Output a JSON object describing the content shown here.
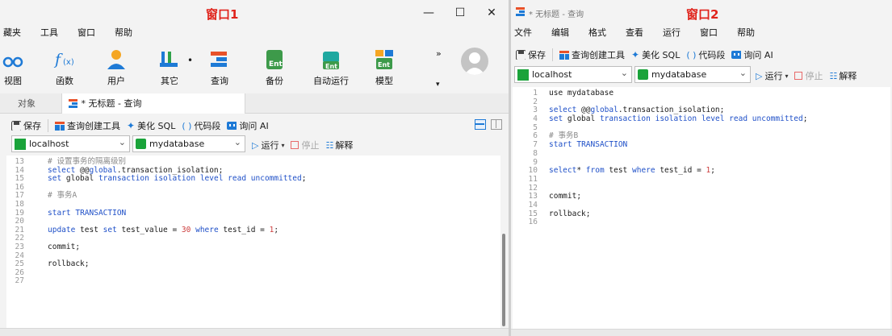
{
  "window1": {
    "title": "窗口1",
    "menu": [
      "藏夹",
      "工具",
      "窗口",
      "帮助"
    ],
    "ribbon": [
      {
        "label": "视图",
        "icon": "view-icon"
      },
      {
        "label": "函数",
        "icon": "function-icon"
      },
      {
        "label": "用户",
        "icon": "user-icon"
      },
      {
        "label": "其它",
        "icon": "tools-icon"
      },
      {
        "label": "查询",
        "icon": "query-icon"
      },
      {
        "label": "备份",
        "icon": "backup-icon"
      },
      {
        "label": "自动运行",
        "icon": "automation-icon"
      },
      {
        "label": "模型",
        "icon": "model-icon"
      }
    ],
    "overflow": "»",
    "tabs": {
      "objects": "对象",
      "query": "* 无标题 - 查询"
    },
    "toolbar": {
      "save": "保存",
      "builder": "查询创建工具",
      "beautify": "美化 SQL",
      "snippet": "代码段",
      "ai": "询问 AI"
    },
    "connection": "localhost",
    "database": "mydatabase",
    "run": {
      "run": "运行",
      "stop": "停止",
      "explain": "解释"
    },
    "code": [
      {
        "n": "13",
        "t": "# 设置事务的隔离级别"
      },
      {
        "n": "14",
        "t": "select @@global.transaction_isolation;"
      },
      {
        "n": "15",
        "t": "set global transaction isolation level read uncommitted;"
      },
      {
        "n": "16",
        "t": ""
      },
      {
        "n": "17",
        "t": "# 事务A"
      },
      {
        "n": "18",
        "t": ""
      },
      {
        "n": "19",
        "t": "start TRANSACTION"
      },
      {
        "n": "20",
        "t": ""
      },
      {
        "n": "21",
        "t": "update test set test_value = 30 where test_id = 1;"
      },
      {
        "n": "22",
        "t": ""
      },
      {
        "n": "23",
        "t": "commit;"
      },
      {
        "n": "24",
        "t": ""
      },
      {
        "n": "25",
        "t": "rollback;"
      },
      {
        "n": "26",
        "t": ""
      },
      {
        "n": "27",
        "t": ""
      }
    ]
  },
  "window2": {
    "doc_title": "* 无标题 - 查询",
    "title": "窗口2",
    "menu": [
      "文件",
      "编辑",
      "格式",
      "查看",
      "运行",
      "窗口",
      "帮助"
    ],
    "toolbar": {
      "save": "保存",
      "builder": "查询创建工具",
      "beautify": "美化 SQL",
      "snippet": "代码段",
      "ai": "询问 AI"
    },
    "connection": "localhost",
    "database": "mydatabase",
    "run": {
      "run": "运行",
      "stop": "停止",
      "explain": "解释"
    },
    "code": [
      {
        "n": "1",
        "t": "use mydatabase"
      },
      {
        "n": "2",
        "t": ""
      },
      {
        "n": "3",
        "t": "select @@global.transaction_isolation;"
      },
      {
        "n": "4",
        "t": "set global transaction isolation level read uncommitted;"
      },
      {
        "n": "5",
        "t": ""
      },
      {
        "n": "6",
        "t": "# 事务B"
      },
      {
        "n": "7",
        "t": "start TRANSACTION"
      },
      {
        "n": "8",
        "t": ""
      },
      {
        "n": "9",
        "t": ""
      },
      {
        "n": "10",
        "t": "select* from test where test_id = 1;"
      },
      {
        "n": "11",
        "t": ""
      },
      {
        "n": "12",
        "t": ""
      },
      {
        "n": "13",
        "t": "commit;"
      },
      {
        "n": "14",
        "t": ""
      },
      {
        "n": "15",
        "t": "rollback;"
      },
      {
        "n": "16",
        "t": ""
      }
    ]
  },
  "colors": {
    "accent_red": "#e0241c",
    "keyword_blue": "#1f50c8",
    "host_green": "#1aa33a",
    "db_green": "#1aa33a"
  }
}
